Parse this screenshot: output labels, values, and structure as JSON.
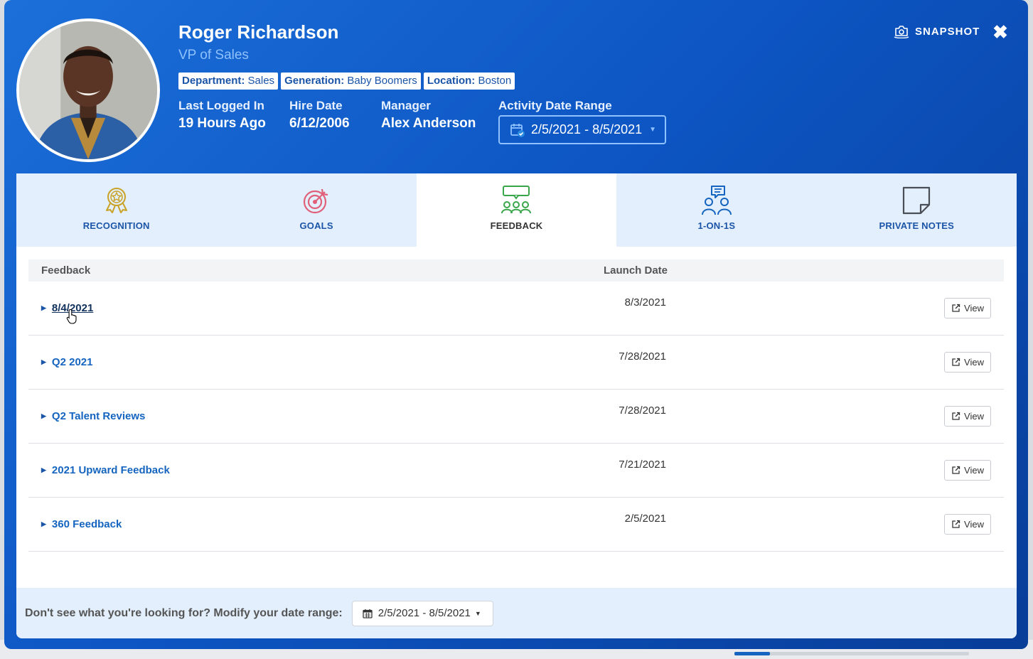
{
  "profile": {
    "name": "Roger Richardson",
    "role": "VP of Sales",
    "tags": [
      {
        "label": "Department:",
        "value": "Sales"
      },
      {
        "label": "Generation:",
        "value": "Baby Boomers"
      },
      {
        "label": "Location:",
        "value": "Boston"
      }
    ],
    "meta": {
      "last_logged_in_label": "Last Logged In",
      "last_logged_in_value": "19 Hours Ago",
      "hire_date_label": "Hire Date",
      "hire_date_value": "6/12/2006",
      "manager_label": "Manager",
      "manager_value": "Alex Anderson",
      "activity_range_label": "Activity Date Range",
      "activity_range_value": "2/5/2021 - 8/5/2021"
    }
  },
  "header": {
    "snapshot_label": "SNAPSHOT",
    "close_glyph": "✖"
  },
  "tabs": [
    {
      "label": "RECOGNITION",
      "icon": "award-ribbon-icon",
      "color": "#c9a227"
    },
    {
      "label": "GOALS",
      "icon": "target-icon",
      "color": "#e0607a"
    },
    {
      "label": "FEEDBACK",
      "icon": "group-speech-icon",
      "color": "#3aa64a",
      "active": true
    },
    {
      "label": "1-ON-1S",
      "icon": "two-people-chat-icon",
      "color": "#1565c0"
    },
    {
      "label": "PRIVATE NOTES",
      "icon": "sticky-note-icon",
      "color": "#4a4f57"
    }
  ],
  "table": {
    "headers": {
      "feedback": "Feedback",
      "launch_date": "Launch Date"
    },
    "view_label": "View",
    "rows": [
      {
        "title": "8/4/2021",
        "date": "8/3/2021"
      },
      {
        "title": "Q2 2021",
        "date": "7/28/2021"
      },
      {
        "title": "Q2 Talent Reviews",
        "date": "7/28/2021"
      },
      {
        "title": "2021 Upward Feedback",
        "date": "7/21/2021"
      },
      {
        "title": "360 Feedback",
        "date": "2/5/2021"
      }
    ]
  },
  "footer": {
    "message": "Don't see what you're looking for? Modify your date range:",
    "date_range": "2/5/2021 - 8/5/2021"
  }
}
